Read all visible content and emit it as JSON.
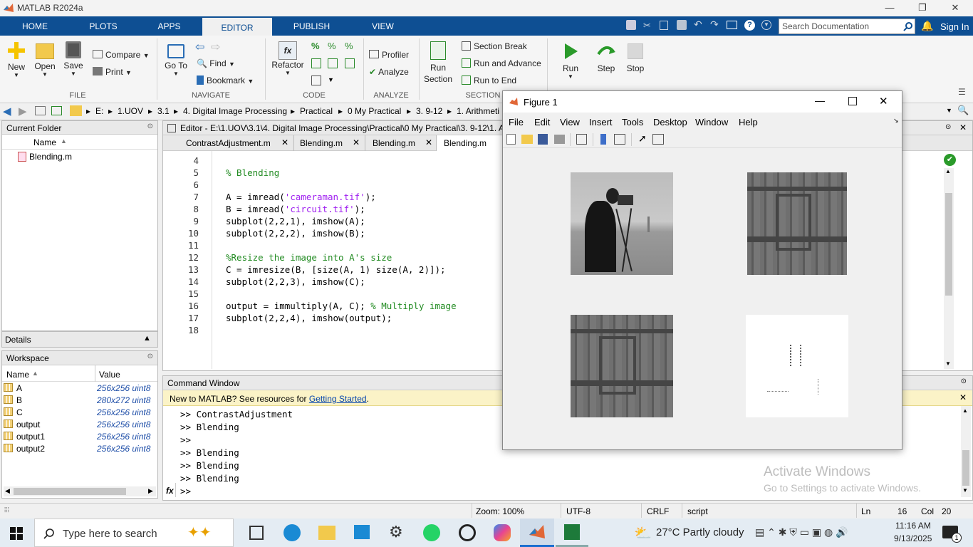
{
  "window": {
    "title": "MATLAB R2024a",
    "minimize": "—",
    "restore": "❐",
    "close": "✕"
  },
  "ribbon_tabs": [
    "HOME",
    "PLOTS",
    "APPS",
    "EDITOR",
    "PUBLISH",
    "VIEW"
  ],
  "search": {
    "placeholder": "Search Documentation"
  },
  "sign_in": "Sign In",
  "ribbon": {
    "file": {
      "new": "New",
      "open": "Open",
      "save": "Save",
      "compare": "Compare",
      "print": "Print",
      "label": "FILE"
    },
    "navigate": {
      "goto": "Go To",
      "find": "Find",
      "bookmark": "Bookmark",
      "label": "NAVIGATE"
    },
    "code": {
      "refactor": "Refactor",
      "label": "CODE"
    },
    "analyze": {
      "profiler": "Profiler",
      "analyze": "Analyze",
      "label": "ANALYZE"
    },
    "section": {
      "run_section": "Run Section",
      "section_break": "Section Break",
      "run_and_advance": "Run and Advance",
      "run_to_end": "Run to End",
      "label": "SECTION"
    },
    "run": {
      "run": "Run",
      "step": "Step",
      "stop": "Stop"
    }
  },
  "breadcrumb": [
    "E:",
    "1.UOV",
    "3.1",
    "4. Digital Image Processing",
    "Practical",
    "0 My Practical",
    "3. 9-12",
    "1. Arithmeti"
  ],
  "current_folder": {
    "title": "Current Folder",
    "col_name": "Name",
    "files": [
      "Blending.m"
    ]
  },
  "details": {
    "title": "Details"
  },
  "workspace": {
    "title": "Workspace",
    "col_name": "Name",
    "col_value": "Value",
    "rows": [
      {
        "name": "A",
        "value": "256x256 uint8"
      },
      {
        "name": "B",
        "value": "280x272 uint8"
      },
      {
        "name": "C",
        "value": "256x256 uint8"
      },
      {
        "name": "output",
        "value": "256x256 uint8"
      },
      {
        "name": "output1",
        "value": "256x256 uint8"
      },
      {
        "name": "output2",
        "value": "256x256 uint8"
      }
    ]
  },
  "editor": {
    "title": "Editor - E:\\1.UOV\\3.1\\4. Digital Image Processing\\Practical\\0 My Practical\\3. 9-12\\1. Ari",
    "tabs": [
      "ContrastAdjustment.m",
      "Blending.m",
      "Blending.m",
      "Blending.m"
    ],
    "line_numbers": [
      "4",
      "5",
      "6",
      "7",
      "8",
      "9",
      "10",
      "11",
      "12",
      "13",
      "14",
      "15",
      "16",
      "17",
      "18"
    ]
  },
  "command_window": {
    "title": "Command Window",
    "banner": "New to MATLAB? See resources for ",
    "banner_link": "Getting Started",
    "banner_end": ".",
    "lines": [
      ">> ContrastAdjustment",
      ">> Blending",
      ">>",
      ">> Blending",
      ">> Blending",
      ">> Blending"
    ],
    "prompt": ">>",
    "fx": "fx"
  },
  "figure": {
    "title": "Figure 1",
    "menu": [
      "File",
      "Edit",
      "View",
      "Insert",
      "Tools",
      "Desktop",
      "Window",
      "Help"
    ]
  },
  "watermark": {
    "line1": "Activate Windows",
    "line2": "Go to Settings to activate Windows."
  },
  "status": {
    "zoom": "Zoom: 100%",
    "encoding": "UTF-8",
    "eol": "CRLF",
    "mode": "script",
    "ln_label": "Ln",
    "ln": "16",
    "col_label": "Col",
    "col": "20"
  },
  "taskbar": {
    "search": "Type here to search",
    "weather": "27°C  Partly cloudy",
    "time": "11:16 AM",
    "date": "9/13/2025",
    "notif": "1"
  }
}
